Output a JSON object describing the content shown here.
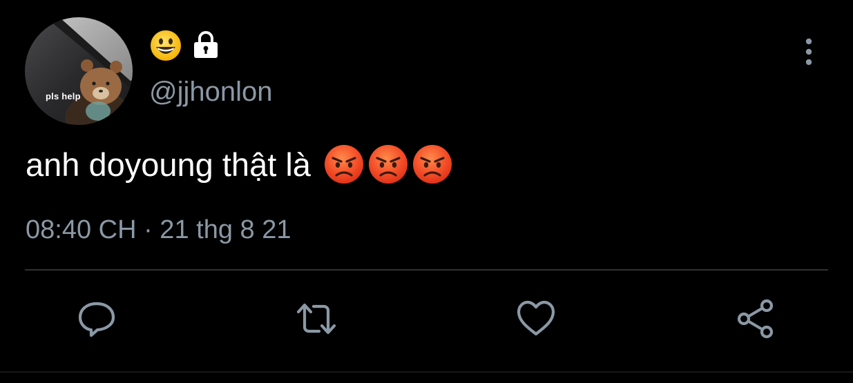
{
  "tweet": {
    "avatar": {
      "caption": "pls help",
      "icon": "teddy-bear-avatar"
    },
    "display_name_icons": [
      "grinning-face-emoji",
      "lock-icon"
    ],
    "handle": "@jjhonlon",
    "text": "anh doyoung thật là",
    "text_emojis": [
      "pouting-face-emoji",
      "pouting-face-emoji",
      "pouting-face-emoji"
    ],
    "timestamp": "08:40 CH · 21 thg 8 21"
  },
  "actions": [
    "reply-icon",
    "retweet-icon",
    "like-icon",
    "share-icon"
  ],
  "colors": {
    "background": "#000000",
    "text_primary": "#ffffff",
    "text_secondary": "#8b98a5",
    "icon": "#8b98a5",
    "divider": "#2f3336"
  }
}
